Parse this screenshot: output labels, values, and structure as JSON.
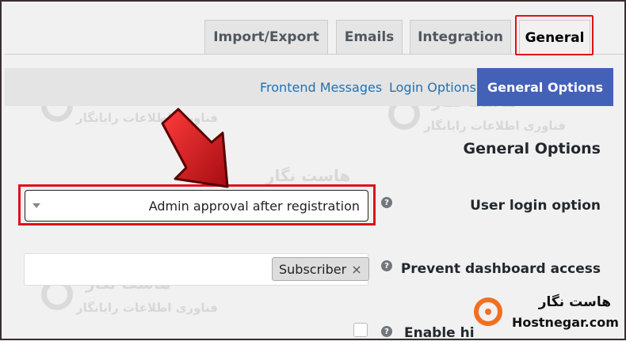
{
  "tabs": [
    {
      "label": "Import/Export",
      "active": false
    },
    {
      "label": "Emails",
      "active": false
    },
    {
      "label": "Integration",
      "active": false
    },
    {
      "label": "General",
      "active": true
    }
  ],
  "subnav": [
    {
      "label": "Frontend Messages",
      "active": false
    },
    {
      "label": "Login Options",
      "active": false
    },
    {
      "label": "General Options",
      "active": true
    }
  ],
  "section_title": "General Options",
  "fields": {
    "user_login_option": {
      "label": "User login option",
      "value": "Admin approval after registration",
      "help": "?"
    },
    "prevent_dashboard": {
      "label": "Prevent dashboard access",
      "chip": "Subscriber",
      "chip_remove": "×",
      "help": "?"
    },
    "enable_hide": {
      "label": "Enable hi",
      "help": "?"
    }
  },
  "watermark": {
    "line1": "هاست نگار",
    "line2": "فناوری اطلاعات رایانگار"
  },
  "brand": {
    "fa": "هاست نگار",
    "en": "Hostnegar.com"
  },
  "colors": {
    "accent": "#4461b8",
    "highlight": "#e0101b",
    "arrow": "#d4141b",
    "brand": "#f26f21"
  },
  "icons": {
    "arrow": "red-down-right-arrow",
    "help": "question-circle-icon",
    "dropdown": "triangle-down-icon"
  }
}
